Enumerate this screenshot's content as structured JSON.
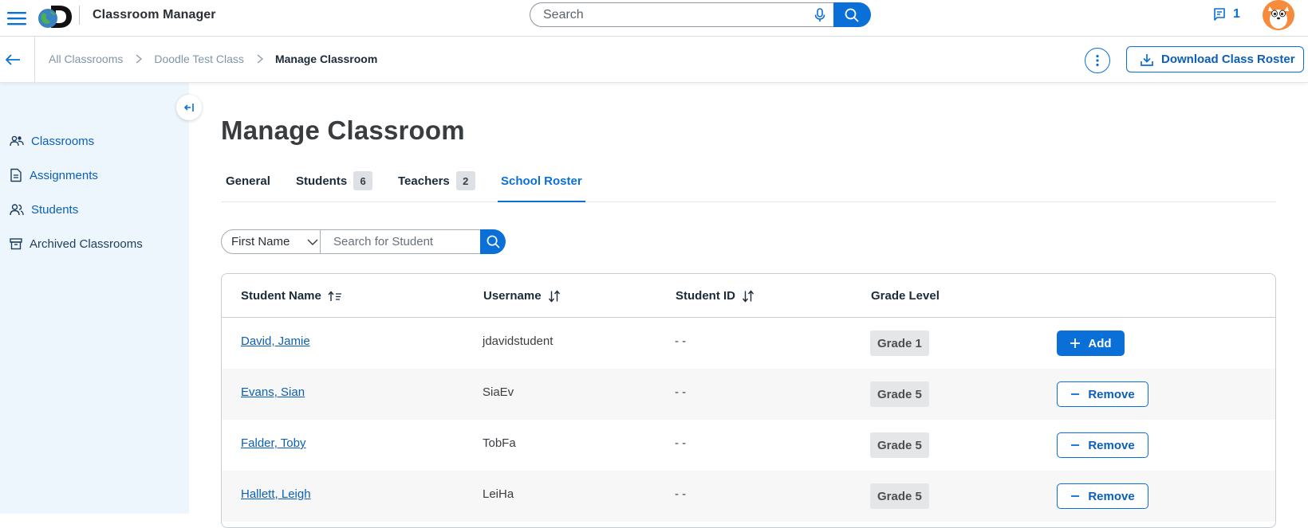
{
  "header": {
    "title": "Classroom Manager",
    "search_placeholder": "Search",
    "notification_count": "1",
    "accent_color": "#0a6fd6"
  },
  "breadcrumb": {
    "items": [
      "All Classrooms",
      "Doodle Test Class"
    ],
    "current": "Manage Classroom",
    "download_label": "Download Class Roster"
  },
  "sidebar": {
    "items": [
      {
        "label": "Classrooms",
        "icon": "classrooms-icon"
      },
      {
        "label": "Assignments",
        "icon": "assignments-icon"
      },
      {
        "label": "Students",
        "icon": "students-icon"
      },
      {
        "label": "Archived Classrooms",
        "icon": "archive-icon"
      }
    ]
  },
  "main": {
    "title": "Manage Classroom",
    "tabs": [
      {
        "label": "General"
      },
      {
        "label": "Students",
        "count": "6"
      },
      {
        "label": "Teachers",
        "count": "2"
      },
      {
        "label": "School Roster",
        "active": true
      }
    ],
    "filter": {
      "field": "First Name",
      "placeholder": "Search for Student"
    },
    "table": {
      "columns": [
        "Student Name",
        "Username",
        "Student ID",
        "Grade Level"
      ],
      "rows": [
        {
          "name": "David, Jamie",
          "username": "jdavidstudent",
          "student_id": "- -",
          "grade": "Grade 1",
          "action": "Add"
        },
        {
          "name": "Evans, Sian",
          "username": "SiaEv",
          "student_id": "- -",
          "grade": "Grade 5",
          "action": "Remove"
        },
        {
          "name": "Falder, Toby",
          "username": "TobFa",
          "student_id": "- -",
          "grade": "Grade 5",
          "action": "Remove"
        },
        {
          "name": "Hallett, Leigh",
          "username": "LeiHa",
          "student_id": "- -",
          "grade": "Grade 5",
          "action": "Remove"
        }
      ]
    }
  }
}
